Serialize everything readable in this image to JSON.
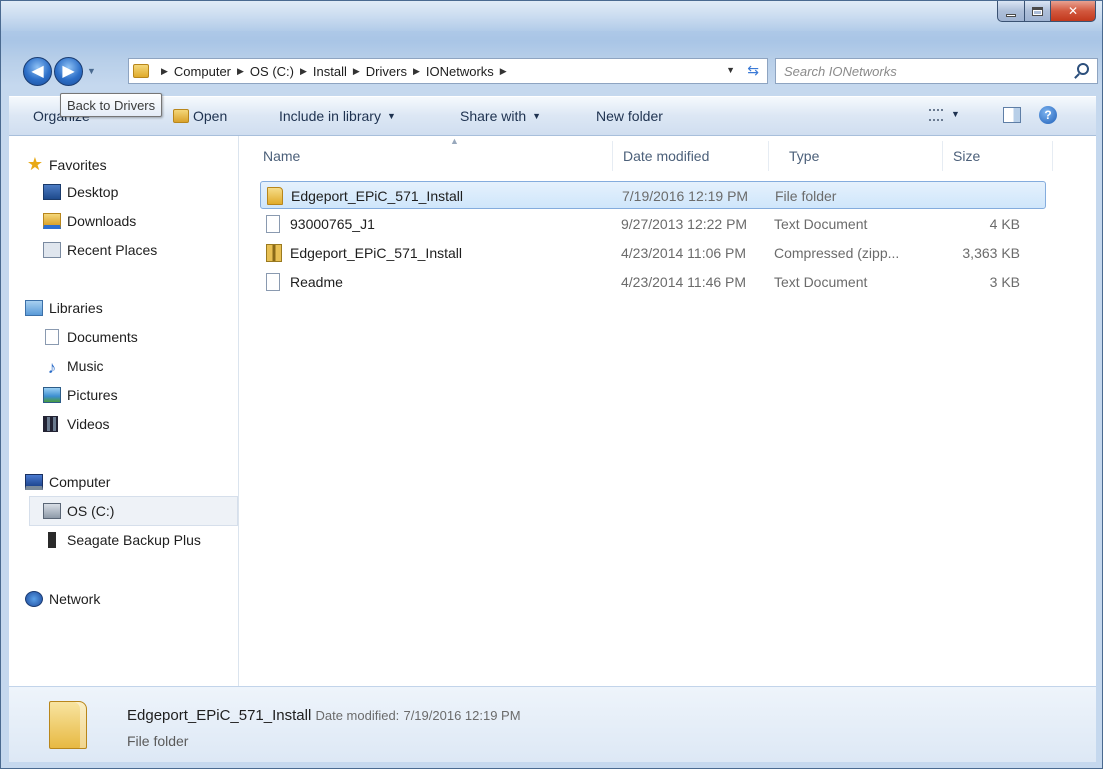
{
  "window": {
    "accent": "#a9c5e6"
  },
  "nav": {
    "back_tooltip": "Back to Drivers",
    "breadcrumbs": [
      "Computer",
      "OS (C:)",
      "Install",
      "Drivers",
      "IONetworks"
    ],
    "search_placeholder": "Search IONetworks"
  },
  "toolbar": {
    "organize": "Organize",
    "open": "Open",
    "include_library": "Include in library",
    "share_with": "Share with",
    "new_folder": "New folder"
  },
  "sidebar": {
    "favorites": "Favorites",
    "desktop": "Desktop",
    "downloads": "Downloads",
    "recent_places": "Recent Places",
    "libraries": "Libraries",
    "documents": "Documents",
    "music": "Music",
    "pictures": "Pictures",
    "videos": "Videos",
    "computer": "Computer",
    "os_c": "OS (C:)",
    "seagate": "Seagate Backup Plus",
    "network": "Network"
  },
  "columns": {
    "name": "Name",
    "date": "Date modified",
    "type": "Type",
    "size": "Size"
  },
  "files": [
    {
      "name": "Edgeport_EPiC_571_Install",
      "date": "7/19/2016 12:19 PM",
      "type": "File folder",
      "size": "",
      "icon": "folder-icon"
    },
    {
      "name": "93000765_J1",
      "date": "9/27/2013 12:22 PM",
      "type": "Text Document",
      "size": "4 KB",
      "icon": "text-file-icon"
    },
    {
      "name": "Edgeport_EPiC_571_Install",
      "date": "4/23/2014 11:06 PM",
      "type": "Compressed (zipp...",
      "size": "3,363 KB",
      "icon": "zip-file-icon"
    },
    {
      "name": "Readme",
      "date": "4/23/2014 11:46 PM",
      "type": "Text Document",
      "size": "3 KB",
      "icon": "text-file-icon"
    }
  ],
  "details": {
    "name": "Edgeport_EPiC_571_Install",
    "date_label": "Date modified:",
    "date_value": "7/19/2016 12:19 PM",
    "type": "File folder"
  }
}
